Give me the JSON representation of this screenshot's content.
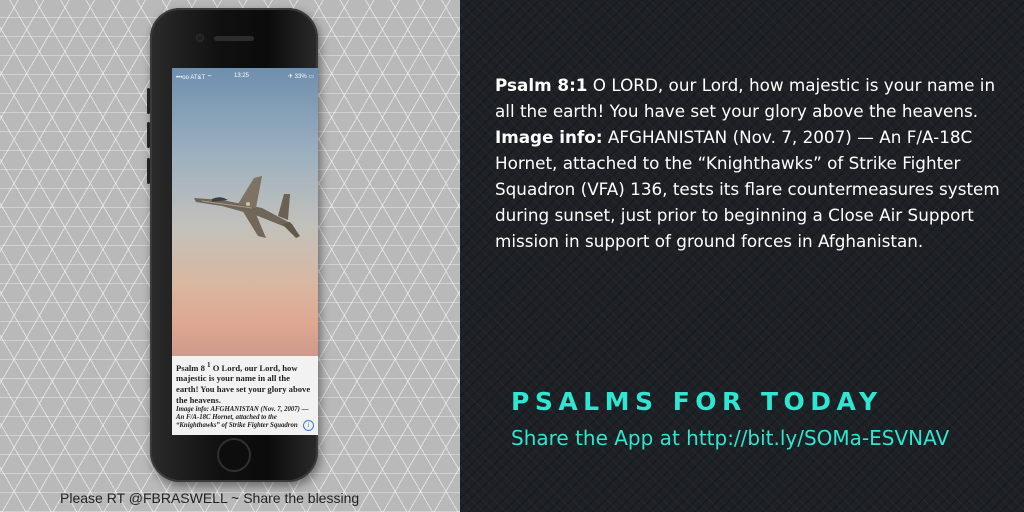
{
  "caption": "Please RT @FBRASWELL ~ Share the blessing",
  "phone": {
    "status": {
      "carrier": "•••oo AT&T ⌔",
      "time": "13:25",
      "battery": "✈ 33% ▭"
    },
    "verse_ref": "Psalm 8",
    "verse_num": "1",
    "verse_text": "O Lord, our Lord, how majestic is your name in all the earth! You have set your glory above the heavens.",
    "info_text": "Image info: AFGHANISTAN (Nov. 7, 2007) — An F/A-18C Hornet, attached to the “Knighthawks” of Strike Fighter Squadron",
    "info_icon": "i"
  },
  "content": {
    "psalm_label": "Psalm 8:1",
    "psalm_text": " O LORD, our Lord, how majestic is your name in all the earth! You have set your glory above the heavens.",
    "image_info_label": "Image info:",
    "image_info_text": " AFGHANISTAN (Nov. 7, 2007) — An F/A-18C Hornet, attached to the “Knighthawks” of Strike Fighter Squadron (VFA) 136, tests its flare countermeasures system during sunset, just prior to beginning a Close Air Support mission in support of ground forces in Afghanistan."
  },
  "brand": "PSALMS FOR TODAY",
  "share": "Share the App at  http://bit.ly/SOMa-ESVNAV",
  "colors": {
    "accent": "#2ee6d2",
    "dark_bg": "#1d2024"
  },
  "icons": {
    "jet": "fighter-jet-icon",
    "info": "info-icon",
    "home": "home-button-icon"
  }
}
